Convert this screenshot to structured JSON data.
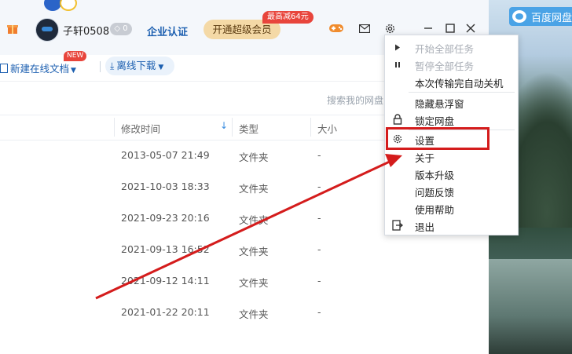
{
  "topbar": {
    "username": "子轩0508",
    "vip_badge": "◇ 0",
    "enterprise_link": "企业认证",
    "vip_button": "开通超级会员",
    "promo_tag": "最高减64元",
    "icons": [
      "gift-icon",
      "gamepad-icon",
      "mail-icon",
      "gear-icon",
      "minimize-icon",
      "maximize-icon",
      "close-icon"
    ]
  },
  "toolbar": {
    "new_doc_label": "新建在线文档",
    "new_tag": "NEW",
    "offline_label": "离线下载"
  },
  "search": {
    "placeholder": "搜索我的网盘"
  },
  "columns": {
    "modified": "修改时间",
    "type": "类型",
    "size": "大小"
  },
  "files": [
    {
      "modified": "2013-05-07 21:49",
      "type": "文件夹",
      "size": "-"
    },
    {
      "modified": "2021-10-03 18:33",
      "type": "文件夹",
      "size": "-"
    },
    {
      "modified": "2021-09-23 20:16",
      "type": "文件夹",
      "size": "-"
    },
    {
      "modified": "2021-09-13 16:52",
      "type": "文件夹",
      "size": "-"
    },
    {
      "modified": "2021-09-12 14:11",
      "type": "文件夹",
      "size": "-"
    },
    {
      "modified": "2021-01-22 20:11",
      "type": "文件夹",
      "size": "-"
    }
  ],
  "menu": {
    "items": [
      {
        "label": "开始全部任务",
        "disabled": true,
        "icon": "play-icon"
      },
      {
        "label": "暂停全部任务",
        "disabled": true,
        "icon": "pause-icon"
      },
      {
        "label": "本次传输完自动关机",
        "disabled": false,
        "icon": ""
      },
      {
        "label": "隐藏悬浮窗",
        "disabled": false,
        "icon": ""
      },
      {
        "label": "锁定网盘",
        "disabled": false,
        "icon": "lock-icon"
      },
      {
        "label": "设置",
        "disabled": false,
        "icon": "gear-icon"
      },
      {
        "label": "关于",
        "disabled": false,
        "icon": ""
      },
      {
        "label": "版本升级",
        "disabled": false,
        "icon": ""
      },
      {
        "label": "问题反馈",
        "disabled": false,
        "icon": ""
      },
      {
        "label": "使用帮助",
        "disabled": false,
        "icon": ""
      },
      {
        "label": "退出",
        "disabled": false,
        "icon": "exit-icon"
      }
    ]
  },
  "background_badge": {
    "label": "百度网盘"
  },
  "colors": {
    "accent": "#1c5fb0",
    "highlight_box": "#d41c1c",
    "vip_button_bg": "#f4d9a6",
    "promo_red": "#e8453c"
  }
}
